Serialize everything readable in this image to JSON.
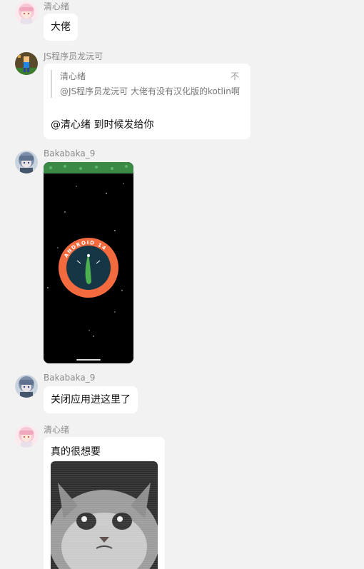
{
  "messages": [
    {
      "sender": "清心绪",
      "text": "大佬"
    },
    {
      "sender": "JS程序员龙沅可",
      "quote": {
        "author": "清心绪",
        "text": "@JS程序员龙沅可 大佬有没有汉化版的kotlin啊",
        "tag": "不"
      },
      "text": "@清心绪 到时候发给你"
    },
    {
      "sender": "Bakabaka_9",
      "image_label": "ANDROID 14"
    },
    {
      "sender": "Bakabaka_9",
      "text": "关闭应用进这里了"
    },
    {
      "sender": "清心绪",
      "text": "真的很想要"
    }
  ],
  "colors": {
    "background": "#f2f2f2",
    "bubble": "#ffffff",
    "android_ring": "#f26a3d",
    "android_green": "#4caf50"
  },
  "icons": [
    "anime-girl-avatar",
    "pixel-character-avatar",
    "blue-hair-avatar",
    "crying-cat-meme"
  ]
}
